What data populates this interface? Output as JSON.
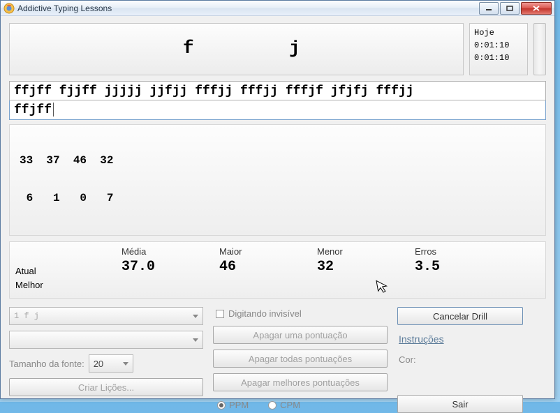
{
  "window": {
    "title": "Addictive Typing Lessons"
  },
  "display": {
    "letter1": "f",
    "letter2": "j"
  },
  "today": {
    "label": "Hoje",
    "t1": "0:01:10",
    "t2": "0:01:10"
  },
  "target_line": "ffjff fjjff jjjjj jjfjj fffjj fffjj fffjf jfjfj fffjj",
  "input_line": "ffjff",
  "speed_grid": {
    "line1": "33  37  46  32",
    "line2": " 6   1   0   7"
  },
  "stats": {
    "headers": {
      "media": "Média",
      "maior": "Maior",
      "menor": "Menor",
      "erros": "Erros"
    },
    "rowlabel_atual": "Atual",
    "rowlabel_melhor": "Melhor",
    "values": {
      "media": "37.0",
      "maior": "46",
      "menor": "32",
      "erros": "3.5"
    }
  },
  "controls": {
    "lesson_combo": "1  f j",
    "font_label": "Tamanho da fonte:",
    "font_value": "20",
    "create_lessons": "Criar Lições...",
    "invisible_typing": "Digitando invisível",
    "clear_one": "Apagar uma pontuação",
    "clear_all": "Apagar todas pontuações",
    "clear_best": "Apagar melhores pontuações",
    "ppm": "PPM",
    "cpm": "CPM",
    "cancel": "Cancelar Drill",
    "instructions": "Instruções",
    "cor": "Cor:",
    "exit": "Sair"
  }
}
